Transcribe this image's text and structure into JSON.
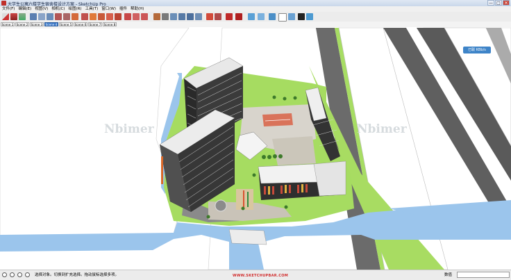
{
  "window": {
    "title": "大学生公寓六楼学生宿舍楼设计方案 - SketchUp Pro",
    "min": "—",
    "max": "□",
    "close": "✕"
  },
  "menu": [
    "文件(F)",
    "编辑(E)",
    "视图(V)",
    "相机(C)",
    "绘图(R)",
    "工具(T)",
    "窗口(W)",
    "插件",
    "帮助(H)"
  ],
  "scene_tabs": [
    "Scene 1",
    "Scene 2",
    "Scene 3",
    "Scene 4",
    "Scene 5",
    "Scene 6",
    "Scene 7",
    "Scene 8"
  ],
  "active_scene": "Scene 4",
  "badge": "已联 KBb/s",
  "watermarks": [
    "Nbimer",
    "Nbimer"
  ],
  "status": {
    "message": "选择对象。切换到扩充选择。拖动鼠标选择多项。",
    "url": "WWW.SKETCHUPBAR.COM",
    "vcb_label": "数值"
  },
  "colors": {
    "accent": "#3a78c9",
    "ground": "#a6dc61",
    "water": "#99c4ea",
    "road": "#6e6e6e"
  }
}
